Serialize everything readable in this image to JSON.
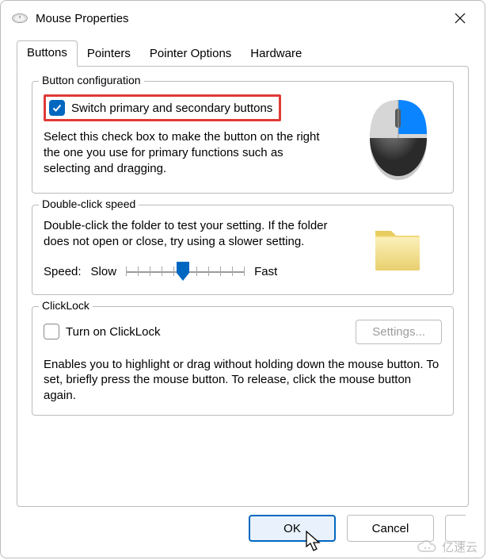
{
  "window": {
    "title": "Mouse Properties"
  },
  "tabs": {
    "items": [
      {
        "label": "Buttons",
        "active": true
      },
      {
        "label": "Pointers",
        "active": false
      },
      {
        "label": "Pointer Options",
        "active": false
      },
      {
        "label": "Hardware",
        "active": false
      }
    ]
  },
  "button_config": {
    "group_label": "Button configuration",
    "switch_checked": true,
    "switch_label": "Switch primary and secondary buttons",
    "description": "Select this check box to make the button on the right the one you use for primary functions such as selecting and dragging."
  },
  "double_click": {
    "group_label": "Double-click speed",
    "description": "Double-click the folder to test your setting. If the folder does not open or close, try using a slower setting.",
    "speed_label": "Speed:",
    "slow_label": "Slow",
    "fast_label": "Fast",
    "ticks": 11,
    "value_percent": 48
  },
  "clicklock": {
    "group_label": "ClickLock",
    "turn_on_checked": false,
    "turn_on_label": "Turn on ClickLock",
    "settings_label": "Settings...",
    "settings_enabled": false,
    "description": "Enables you to highlight or drag without holding down the mouse button. To set, briefly press the mouse button. To release, click the mouse button again."
  },
  "footer": {
    "ok_label": "OK",
    "cancel_label": "Cancel"
  },
  "watermark": {
    "text": "亿速云"
  }
}
